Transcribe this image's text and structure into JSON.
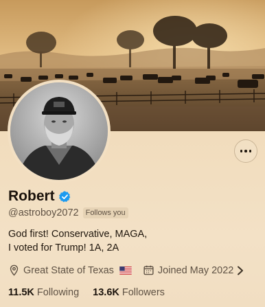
{
  "profile": {
    "name": "Robert",
    "handle": "@astroboy2072",
    "follows_you": "Follows you",
    "bio_lines": [
      "God first!  Conservative, MAGA,",
      "I voted for Trump! 1A, 2A"
    ],
    "location": "Great State of Texas",
    "joined": "Joined May 2022",
    "following_count": "11.5K",
    "following_label": "Following",
    "followers_count": "13.6K",
    "followers_label": "Followers"
  },
  "icons": {
    "more": "more-horizontal-icon",
    "verified": "verified-badge-icon",
    "location": "location-pin-icon",
    "calendar": "calendar-icon",
    "flag": "us-flag-icon",
    "chevron": "chevron-right-icon"
  },
  "colors": {
    "verified_blue": "#1d9bf0",
    "background": "#f3e0c3",
    "text_primary": "#1a120b",
    "text_secondary": "#5f5244"
  }
}
